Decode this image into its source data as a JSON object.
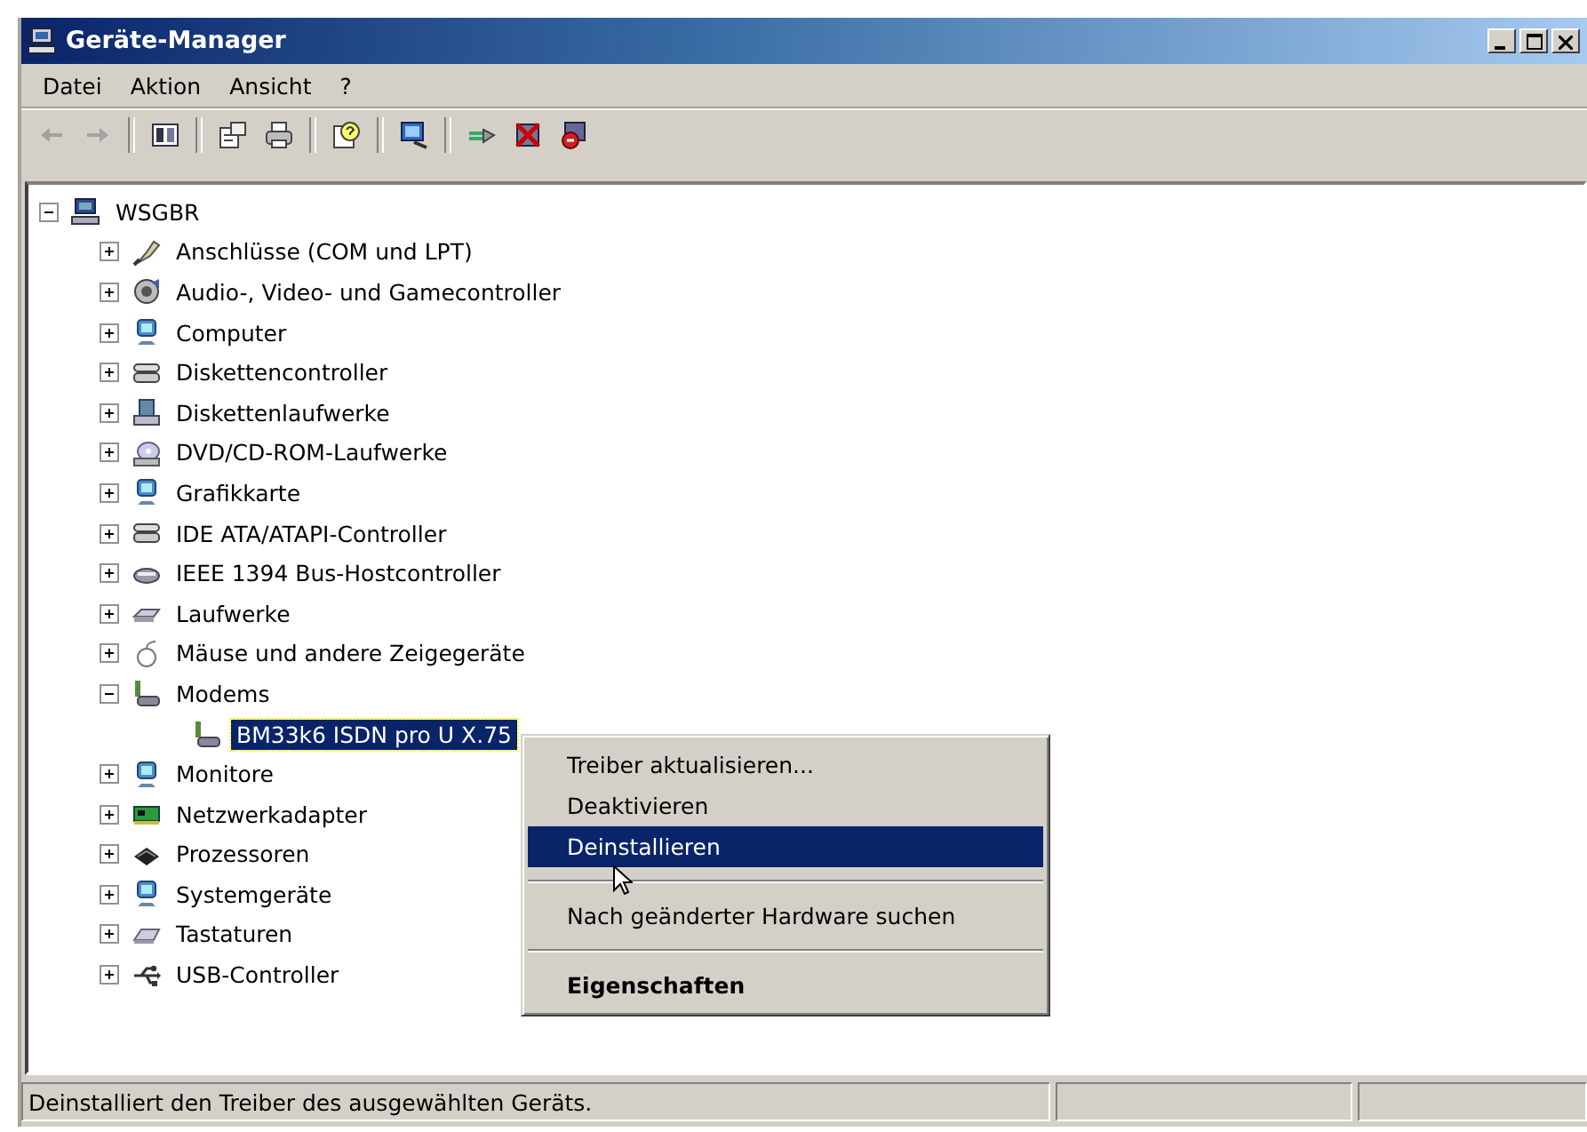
{
  "window": {
    "title": "Geräte-Manager"
  },
  "menu_bar": [
    {
      "label": "Datei"
    },
    {
      "label": "Aktion"
    },
    {
      "label": "Ansicht"
    },
    {
      "label": "?"
    }
  ],
  "toolbar": [
    {
      "kind": "back",
      "disabled": true
    },
    {
      "kind": "forward",
      "disabled": true
    },
    {
      "kind": "separator"
    },
    {
      "kind": "tree-toggle",
      "disabled": false
    },
    {
      "kind": "separator"
    },
    {
      "kind": "properties",
      "disabled": false
    },
    {
      "kind": "print",
      "disabled": false
    },
    {
      "kind": "separator"
    },
    {
      "kind": "help",
      "disabled": false
    },
    {
      "kind": "separator"
    },
    {
      "kind": "scan",
      "disabled": false
    },
    {
      "kind": "separator"
    },
    {
      "kind": "update",
      "disabled": false
    },
    {
      "kind": "disable",
      "disabled": false
    },
    {
      "kind": "uninstall",
      "disabled": false
    }
  ],
  "tree": {
    "label": "WSGBR",
    "kind": "computer",
    "expanded": true,
    "selected": false,
    "children": [
      {
        "label": "Anschlüsse (COM und LPT)",
        "kind": "port",
        "expanded": false,
        "selected": false
      },
      {
        "label": "Audio-, Video- und Gamecontroller",
        "kind": "audio",
        "expanded": false,
        "selected": false
      },
      {
        "label": "Computer",
        "kind": "monitor",
        "expanded": false,
        "selected": false
      },
      {
        "label": "Diskettencontroller",
        "kind": "controller",
        "expanded": false,
        "selected": false
      },
      {
        "label": "Diskettenlaufwerke",
        "kind": "floppy",
        "expanded": false,
        "selected": false
      },
      {
        "label": "DVD/CD-ROM-Laufwerke",
        "kind": "cdrom",
        "expanded": false,
        "selected": false
      },
      {
        "label": "Grafikkarte",
        "kind": "monitor",
        "expanded": false,
        "selected": false
      },
      {
        "label": "IDE ATA/ATAPI-Controller",
        "kind": "controller",
        "expanded": false,
        "selected": false
      },
      {
        "label": "IEEE 1394 Bus-Hostcontroller",
        "kind": "bus",
        "expanded": false,
        "selected": false
      },
      {
        "label": "Laufwerke",
        "kind": "drive",
        "expanded": false,
        "selected": false
      },
      {
        "label": "Mäuse und andere Zeigegeräte",
        "kind": "mouse",
        "expanded": false,
        "selected": false
      },
      {
        "label": "Modems",
        "kind": "modem",
        "expanded": true,
        "selected": false,
        "children": [
          {
            "label": "BM33k6 ISDN pro U X.75",
            "kind": "modem",
            "selected": true
          }
        ]
      },
      {
        "label": "Monitore",
        "kind": "monitor",
        "expanded": false,
        "selected": false
      },
      {
        "label": "Netzwerkadapter",
        "kind": "network",
        "expanded": false,
        "selected": false
      },
      {
        "label": "Prozessoren",
        "kind": "chip",
        "expanded": false,
        "selected": false
      },
      {
        "label": "Systemgeräte",
        "kind": "monitor",
        "expanded": false,
        "selected": false
      },
      {
        "label": "Tastaturen",
        "kind": "keyboard",
        "expanded": false,
        "selected": false
      },
      {
        "label": "USB-Controller",
        "kind": "usb",
        "expanded": false,
        "selected": false
      }
    ]
  },
  "context_menu": [
    {
      "kind": "item",
      "label": "Treiber aktualisieren...",
      "selected": false,
      "default": false
    },
    {
      "kind": "item",
      "label": "Deaktivieren",
      "selected": false,
      "default": false
    },
    {
      "kind": "item",
      "label": "Deinstallieren",
      "selected": true,
      "default": false
    },
    {
      "kind": "separator"
    },
    {
      "kind": "item",
      "label": "Nach geänderter Hardware suchen",
      "selected": false,
      "default": false
    },
    {
      "kind": "separator"
    },
    {
      "kind": "item",
      "label": "Eigenschaften",
      "selected": false,
      "default": true
    }
  ],
  "status_bar": [
    "Deinstalliert den Treiber des ausgewählten Geräts."
  ]
}
